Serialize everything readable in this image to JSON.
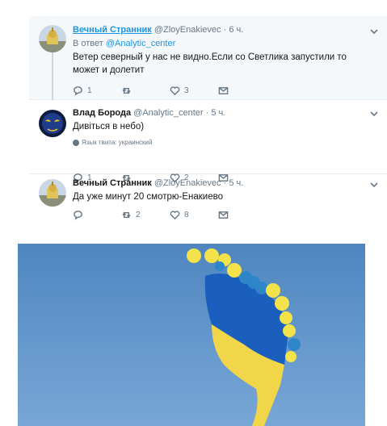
{
  "tweets": [
    {
      "name": "Вечный Странник",
      "handle": "@ZloyEnakievec",
      "time": "6 ч.",
      "reply_prefix": "В ответ",
      "reply_mention": "@Analytic_center",
      "text": "Ветер северный у нас не видно.Если со Светлика запустили то может и долетит",
      "replies": "1",
      "retweets": "",
      "likes": "3"
    },
    {
      "name": "Влад Борода",
      "handle": "@Analytic_center",
      "time": "5 ч.",
      "text": "Дивіться в небо)",
      "lang_label": "Язык твита: украинский",
      "replies": "1",
      "retweets": "",
      "likes": "2"
    },
    {
      "name": "Вечный Странник",
      "handle": "@ZloyEnakievec",
      "time": "5 ч.",
      "text": "Да уже минут 20 смотрю-Енакиево",
      "replies": "",
      "retweets": "2",
      "likes": "8"
    }
  ],
  "separator": "·",
  "colors": {
    "link": "#1b95e0",
    "muted": "#657786",
    "sky": "#5c8fc4",
    "flag_blue": "#1a5fbd",
    "flag_yellow": "#f5d742"
  }
}
